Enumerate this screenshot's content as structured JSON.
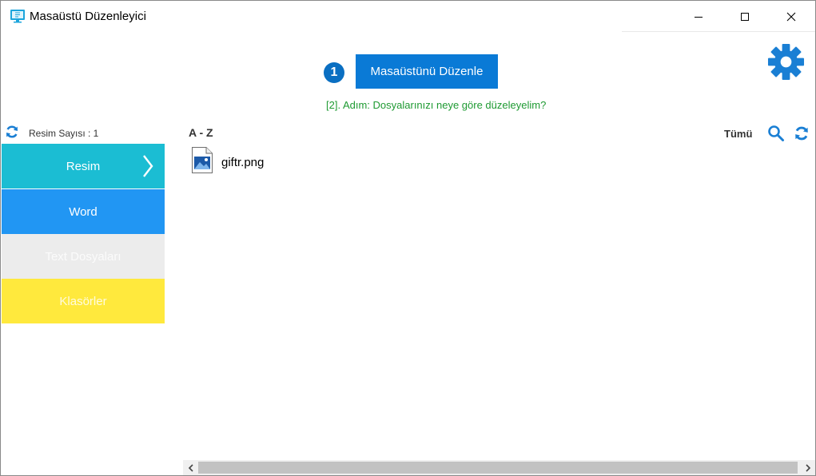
{
  "window": {
    "title": "Masaüstü Düzenleyici"
  },
  "header": {
    "step_number": "1",
    "main_button_label": "Masaüstünü Düzenle",
    "step_hint": "[2]. Adım: Dosyalarınızı neye göre düzeleyelim?"
  },
  "sidebar": {
    "count_label": "Resim Sayısı : 1",
    "items": [
      {
        "label": "Resim",
        "selected": true,
        "color": "#1bbdd3"
      },
      {
        "label": "Word",
        "selected": false,
        "color": "#2196f3"
      },
      {
        "label": "Text Dosyaları",
        "selected": false,
        "color": "#ececec"
      },
      {
        "label": "Klasörler",
        "selected": false,
        "color": "#ffe93d"
      }
    ]
  },
  "content": {
    "sort_label": "A - Z",
    "filter_label": "Tümü",
    "files": [
      {
        "name": "giftr.png",
        "icon": "image-file-icon"
      }
    ]
  },
  "colors": {
    "accent": "#0a7ad6",
    "hint_green": "#1e9a32",
    "icon_blue": "#1a7fd4"
  }
}
